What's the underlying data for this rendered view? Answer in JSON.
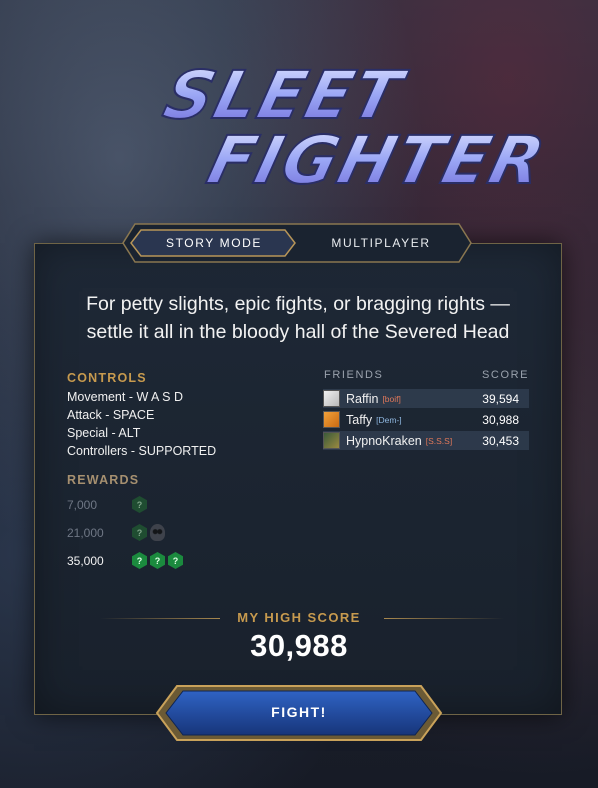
{
  "logo": {
    "line1": "SLEET",
    "line2": "FIGHTER"
  },
  "tabs": [
    {
      "label": "STORY MODE",
      "active": true
    },
    {
      "label": "MULTIPLAYER",
      "active": false
    }
  ],
  "tagline": {
    "line1": "For petty slights, epic fights, or bragging rights —",
    "line2": "settle it all in the bloody hall of the Severed Head"
  },
  "controls": {
    "heading": "CONTROLS",
    "items": [
      "Movement - W A S D",
      "Attack - SPACE",
      "Special - ALT",
      "Controllers - SUPPORTED"
    ]
  },
  "rewards": {
    "heading": "REWARDS",
    "rows": [
      {
        "score": "7,000",
        "icons": [
          "mystery-hex-icon"
        ],
        "unlocked": false
      },
      {
        "score": "21,000",
        "icons": [
          "mystery-hex-icon",
          "skull-icon"
        ],
        "unlocked": false
      },
      {
        "score": "35,000",
        "icons": [
          "mystery-hex-icon",
          "mystery-hex-icon",
          "mystery-hex-icon"
        ],
        "unlocked": true
      }
    ],
    "hex_symbol": "?"
  },
  "friends": {
    "heading": "FRIENDS",
    "score_heading": "SCORE",
    "rows": [
      {
        "name": "Raffin",
        "tag": "[boif]",
        "tag_color": "#e0785a",
        "score": "39,594"
      },
      {
        "name": "Taffy",
        "tag": "[Dem-]",
        "tag_color": "#8fb8e0",
        "score": "30,988"
      },
      {
        "name": "HypnoKraken",
        "tag": "[S.S.S]",
        "tag_color": "#e0785a",
        "score": "30,453"
      }
    ]
  },
  "high_score": {
    "label": "MY HIGH SCORE",
    "value": "30,988"
  },
  "fight_button": {
    "label": "FIGHT!"
  },
  "colors": {
    "gold": "#c79a4e",
    "button_blue": "#1f4fa8",
    "reward_green": "#1b8a3e"
  }
}
